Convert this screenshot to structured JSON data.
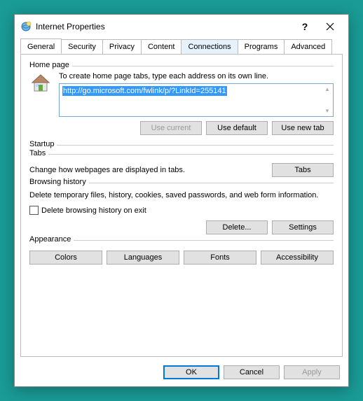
{
  "title": "Internet Properties",
  "tabs": [
    "General",
    "Security",
    "Privacy",
    "Content",
    "Connections",
    "Programs",
    "Advanced"
  ],
  "homepage": {
    "legend": "Home page",
    "desc": "To create home page tabs, type each address on its own line.",
    "url": "http://go.microsoft.com/fwlink/p/?LinkId=255141",
    "use_current": "Use current",
    "use_default": "Use default",
    "use_new_tab": "Use new tab"
  },
  "startup": {
    "legend": "Startup"
  },
  "tabs_section": {
    "legend": "Tabs",
    "desc": "Change how webpages are displayed in tabs.",
    "btn": "Tabs"
  },
  "history": {
    "legend": "Browsing history",
    "desc": "Delete temporary files, history, cookies, saved passwords, and web form information.",
    "checkbox": "Delete browsing history on exit",
    "delete_btn": "Delete...",
    "settings_btn": "Settings"
  },
  "appearance": {
    "legend": "Appearance",
    "colors": "Colors",
    "languages": "Languages",
    "fonts": "Fonts",
    "accessibility": "Accessibility"
  },
  "footer": {
    "ok": "OK",
    "cancel": "Cancel",
    "apply": "Apply"
  }
}
